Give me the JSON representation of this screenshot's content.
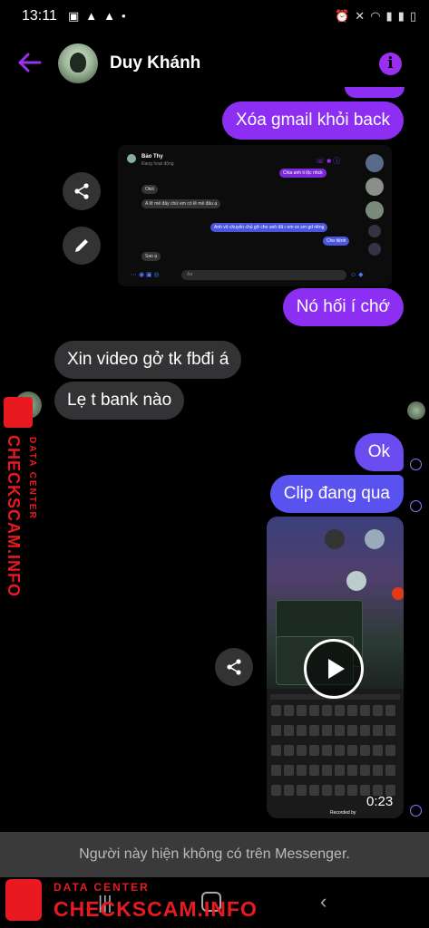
{
  "status_bar": {
    "time": "13:11"
  },
  "header": {
    "contact_name": "Duy Khánh"
  },
  "messages": {
    "m1": "Xóa gmail khỏi back",
    "m2": "Nó hối í chớ",
    "m3": "Xin video gở tk fbđi á",
    "m4": "Lẹ t bank nào",
    "m5": "Ok",
    "m6": "Clip đang qua"
  },
  "embedded_screenshot": {
    "name": "Bảo Thy",
    "status": "Đang hoạt động",
    "msg_a": "Chia anh ti lộc nhck",
    "msg_b": "Okiii",
    "msg_c": "A lỡ mê đây chứ em có lẽ mê đâu ạ",
    "msg_d": "Anh vô chuyến chủ gỡ cho anh đã r em vx sm gd riêng",
    "msg_e": "Cho tiệnh",
    "msg_f": "Sao ạ",
    "input": "Aa"
  },
  "video": {
    "duration": "0:23",
    "recorded_by": "Recorded by"
  },
  "notice": "Người này hiện không có trên Messenger.",
  "watermark": {
    "brand": "CHECKSCAM.INFO",
    "tag": "DATA CENTER"
  },
  "colors": {
    "accent": "#8d2ff2",
    "bubble_in": "#333335",
    "watermark": "#e8191f"
  }
}
